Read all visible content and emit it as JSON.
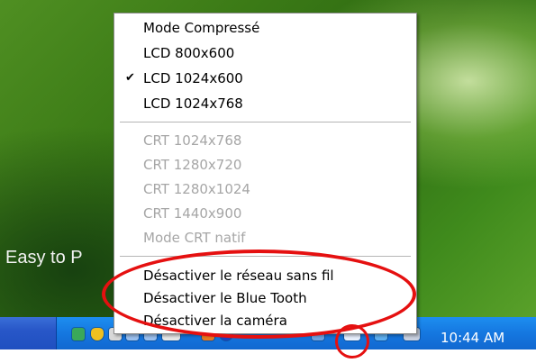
{
  "desktop": {
    "text": "Easy to P"
  },
  "menu": {
    "items": [
      {
        "label": "Mode Compressé",
        "enabled": true,
        "checked": false
      },
      {
        "label": "LCD 800x600",
        "enabled": true,
        "checked": false
      },
      {
        "label": "LCD 1024x600",
        "enabled": true,
        "checked": true
      },
      {
        "label": "LCD 1024x768",
        "enabled": true,
        "checked": false
      },
      {
        "label": "CRT 1024x768",
        "enabled": false,
        "checked": false
      },
      {
        "label": "CRT 1280x720",
        "enabled": false,
        "checked": false
      },
      {
        "label": "CRT 1280x1024",
        "enabled": false,
        "checked": false
      },
      {
        "label": "CRT 1440x900",
        "enabled": false,
        "checked": false
      },
      {
        "label": "Mode CRT natif",
        "enabled": false,
        "checked": false
      },
      {
        "label": "Désactiver le réseau sans fil",
        "enabled": true,
        "checked": false
      },
      {
        "label": "Désactiver le Blue Tooth",
        "enabled": true,
        "checked": false
      },
      {
        "label": "Désactiver la caméra",
        "enabled": true,
        "checked": false
      }
    ],
    "check_glyph": "✔"
  },
  "taskbar": {
    "clock": "10:44 AM",
    "tray_icons": [
      "network-setup-icon",
      "security-shield-icon",
      "volume-icon",
      "network-disconnected-icon",
      "network-disconnected-icon",
      "keyboard-icon",
      "toolbox-icon",
      "bluetooth-icon",
      "display-settings-icon",
      "display-icon",
      "monitor-icon",
      "battery-icon"
    ]
  },
  "colors": {
    "annotation": "#e51010",
    "disabled_text": "#a6a6a6",
    "tray_blue": "#1577e0"
  }
}
